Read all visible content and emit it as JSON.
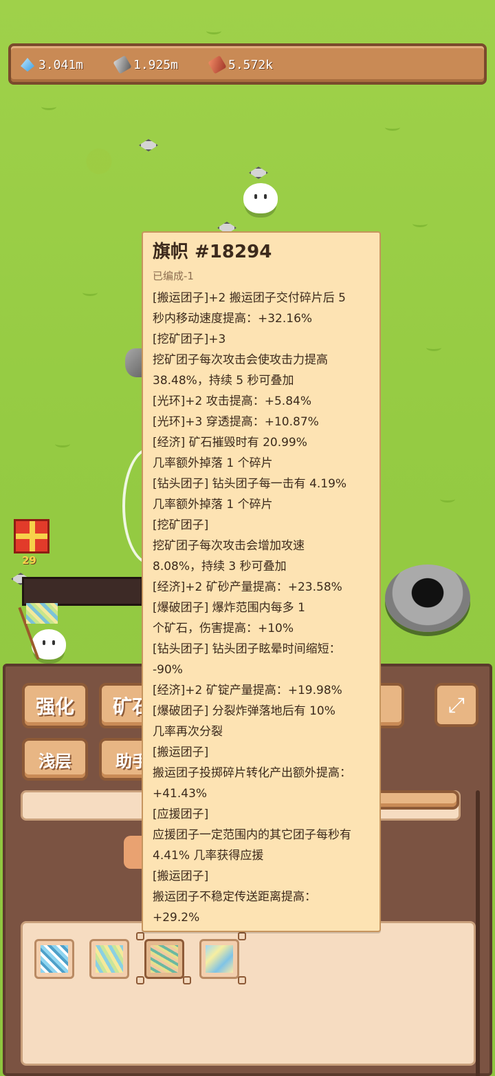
{
  "resources": [
    {
      "icon": "diamond-icon",
      "value": "3.041m"
    },
    {
      "icon": "iron-ingot-icon",
      "value": "1.925m"
    },
    {
      "icon": "copper-ingot-icon",
      "value": "5.572k"
    }
  ],
  "world": {
    "gift_count": "29"
  },
  "tooltip": {
    "title": "旗帜 #18294",
    "subtitle": "已编成-1",
    "lines": [
      "[搬运团子]+2 搬运团子交付碎片后 5",
      "秒内移动速度提高：+32.16%",
      "[挖矿团子]+3",
      "挖矿团子每次攻击会使攻击力提高",
      "38.48%，持续 5 秒可叠加",
      "[光环]+2 攻击提高：+5.84%",
      "[光环]+3 穿透提高：+10.87%",
      "[经济] 矿石摧毁时有 20.99%",
      "几率额外掉落 1 个碎片",
      "[钻头团子] 钻头团子每一击有 4.19%",
      "几率额外掉落 1 个碎片",
      "[挖矿团子]",
      "挖矿团子每次攻击会增加攻速",
      "8.08%，持续 3 秒可叠加",
      "[经济]+2 矿砂产量提高：+23.58%",
      "[爆破团子] 爆炸范围内每多 1",
      "个矿石，伤害提高：+10%",
      "[钻头团子] 钻头团子眩晕时间缩短：",
      "-90%",
      "[经济]+2 矿锭产量提高：+19.98%",
      "[爆破团子] 分裂炸弹落地后有 10%",
      "几率再次分裂",
      "[搬运团子]",
      "搬运团子投掷碎片转化产出额外提高：",
      "+41.43%",
      "[应援团子]",
      "应援团子一定范围内的其它团子每秒有",
      "4.41% 几率获得应援",
      "[搬运团子]",
      "搬运团子不稳定传送距离提高：",
      "+29.2%"
    ]
  },
  "panel": {
    "tabs_row1": [
      "强化",
      "矿石"
    ],
    "tabs_row2": [
      "浅层",
      "助手"
    ],
    "fullscreen_icon": "expand-icon",
    "flag_slots": [
      "flag-slot-1",
      "flag-slot-2",
      "flag-slot-3",
      "flag-slot-4"
    ]
  }
}
